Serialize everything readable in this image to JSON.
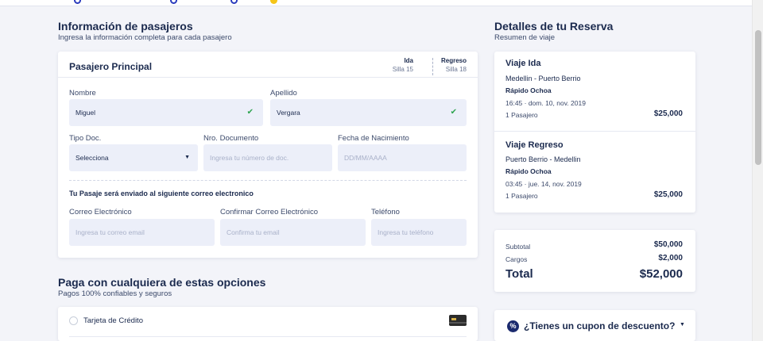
{
  "passengers": {
    "title": "Información de pasajeros",
    "subtitle": "Ingresa la información completa para cada pasajero",
    "card": {
      "title": "Pasajero Principal",
      "ida": {
        "label": "Ida",
        "seat": "Silla 15"
      },
      "regreso": {
        "label": "Regreso",
        "seat": "Silla 18"
      },
      "nombre": {
        "label": "Nombre",
        "value": "Miguel"
      },
      "apellido": {
        "label": "Apellido",
        "value": "Vergara"
      },
      "tipo_doc": {
        "label": "Tipo Doc.",
        "value": "Selecciona"
      },
      "nro_doc": {
        "label": "Nro. Documento",
        "placeholder": "Ingresa tu número de doc."
      },
      "fecha_nac": {
        "label": "Fecha de Nacimiento",
        "placeholder": "DD/MM/AAAA"
      },
      "email_note": "Tu Pasaje será enviado al siguiente correo electronico",
      "email": {
        "label": "Correo Electrónico",
        "placeholder": "Ingresa tu correo email"
      },
      "email_confirm": {
        "label": "Confirmar Correo Electrónico",
        "placeholder": "Confirma tu email"
      },
      "telefono": {
        "label": "Teléfono",
        "placeholder": "Ingresa tu teléfono"
      }
    }
  },
  "payment": {
    "title": "Paga con cualquiera de estas opciones",
    "subtitle": "Pagos 100% confiables y seguros",
    "options": [
      {
        "label": "Tarjeta de Crédito"
      }
    ]
  },
  "booking": {
    "title": "Detalles de tu Reserva",
    "subtitle": "Resumen de viaje",
    "trips": [
      {
        "title": "Viaje Ida",
        "route": "Medellin - Puerto Berrio",
        "company": "Rápido Ochoa",
        "datetime": "16:45 · dom. 10, nov. 2019",
        "passengers": "1 Pasajero",
        "price": "$25,000"
      },
      {
        "title": "Viaje Regreso",
        "route": "Puerto Berrio - Medellin",
        "company": "Rápido Ochoa",
        "datetime": "03:45 · jue. 14, nov. 2019",
        "passengers": "1 Pasajero",
        "price": "$25,000"
      }
    ],
    "summary": {
      "subtotal_label": "Subtotal",
      "subtotal": "$50,000",
      "cargos_label": "Cargos",
      "cargos": "$2,000",
      "total_label": "Total",
      "total": "$52,000"
    },
    "coupon": {
      "icon_text": "%",
      "label": "¿Tienes un cupon de descuento?"
    }
  },
  "icons": {
    "check": "check-icon",
    "caret": "caret-down-icon",
    "card": "credit-card-icon",
    "percent": "percent-badge-icon"
  },
  "colors": {
    "navy": "#1b2a4e",
    "field_bg": "#eceff9",
    "check_green": "#2ea44f",
    "page_bg": "#f3f4f9"
  }
}
